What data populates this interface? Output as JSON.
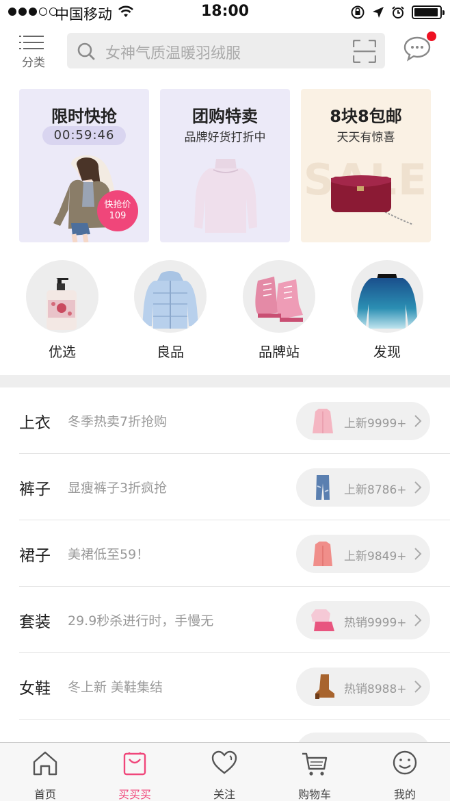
{
  "status_bar": {
    "carrier": "中国移动",
    "time": "18:00",
    "battery_level": 0.95,
    "signal_bars": 3
  },
  "header": {
    "category_label": "分类",
    "search_placeholder": "女神气质温暖羽绒服",
    "has_unread_message": true
  },
  "promos": [
    {
      "title": "限时快抢",
      "timer": "00:59:46",
      "badge_line1": "快抢价",
      "badge_line2": "109",
      "bg": "#eceaf8"
    },
    {
      "title": "团购特卖",
      "subtitle": "品牌好货打折中",
      "bg": "#eceaf8"
    },
    {
      "title": "8块8包邮",
      "subtitle": "天天有惊喜",
      "watermark": "SALE",
      "bg": "#faf1e4"
    }
  ],
  "round_categories": [
    {
      "label": "优选",
      "icon": "lotion-bottle-icon"
    },
    {
      "label": "良品",
      "icon": "down-jacket-icon"
    },
    {
      "label": "品牌站",
      "icon": "pink-shoes-icon"
    },
    {
      "label": "发现",
      "icon": "blue-sweater-icon"
    }
  ],
  "list": [
    {
      "name": "上衣",
      "desc": "冬季热卖7折抢购",
      "count": "上新9999+",
      "thumb": "pink-coat-icon"
    },
    {
      "name": "裤子",
      "desc": "显瘦裤子3折疯抢",
      "count": "上新8786+",
      "thumb": "jeans-icon"
    },
    {
      "name": "裙子",
      "desc": "美裙低至59！",
      "count": "上新9849+",
      "thumb": "coral-coat-icon"
    },
    {
      "name": "套装",
      "desc": "29.9秒杀进行时，手慢无",
      "count": "热销9999+",
      "thumb": "outfit-set-icon"
    },
    {
      "name": "女鞋",
      "desc": "冬上新 美鞋集结",
      "count": "热销8988+",
      "thumb": "brown-boot-icon"
    }
  ],
  "tabbar": {
    "items": [
      {
        "label": "首页",
        "icon": "home-icon"
      },
      {
        "label": "买买买",
        "icon": "shopping-bag-icon",
        "active": true
      },
      {
        "label": "关注",
        "icon": "heart-icon"
      },
      {
        "label": "购物车",
        "icon": "cart-icon"
      },
      {
        "label": "我的",
        "icon": "smiley-profile-icon"
      }
    ],
    "active_color": "#f0467a"
  }
}
